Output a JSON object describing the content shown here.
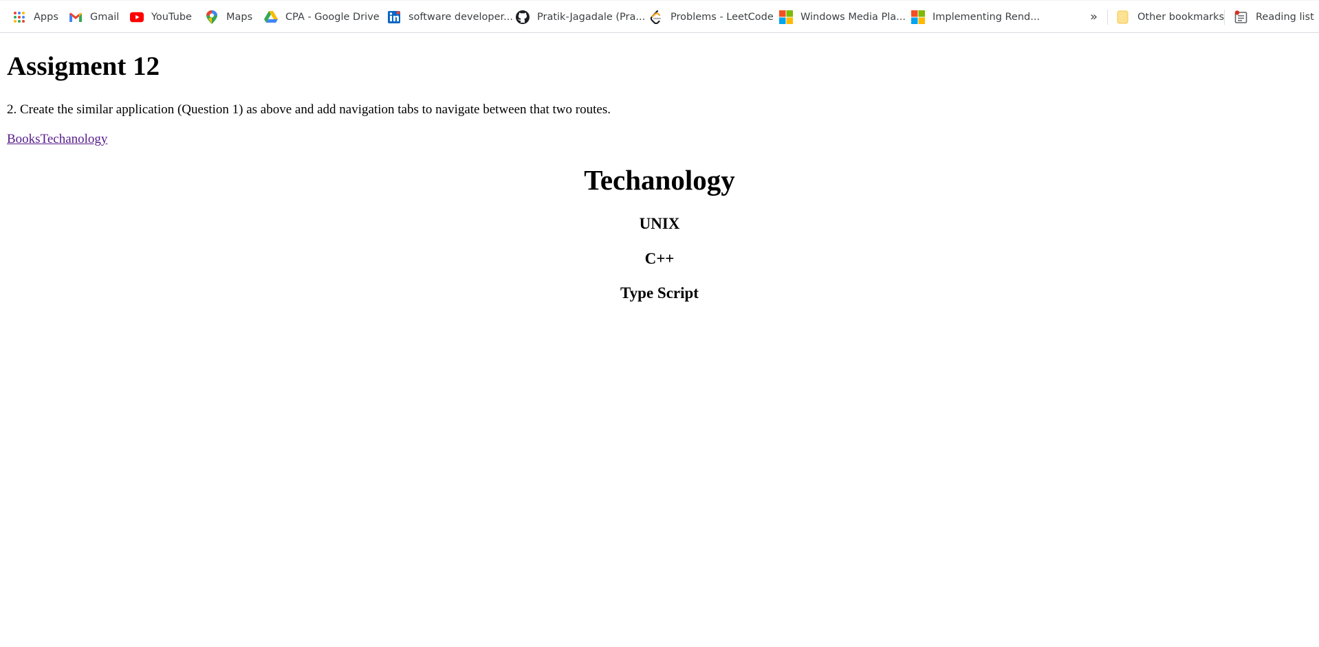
{
  "bookmarks": {
    "items": [
      {
        "label": "Apps",
        "icon": "apps-grid-icon"
      },
      {
        "label": "Gmail",
        "icon": "gmail-icon"
      },
      {
        "label": "YouTube",
        "icon": "youtube-icon"
      },
      {
        "label": "Maps",
        "icon": "maps-pin-icon"
      },
      {
        "label": "CPA - Google Drive",
        "icon": "google-drive-icon"
      },
      {
        "label": "software developer...",
        "icon": "linkedin-icon"
      },
      {
        "label": "Pratik-Jagadale (Pra...",
        "icon": "github-icon"
      },
      {
        "label": "Problems - LeetCode",
        "icon": "leetcode-icon"
      },
      {
        "label": "Windows Media Pla...",
        "icon": "microsoft-icon"
      },
      {
        "label": "Implementing Rend...",
        "icon": "microsoft-icon"
      }
    ],
    "overflow": "»",
    "other_bookmarks": "Other bookmarks",
    "reading_list": "Reading list"
  },
  "page": {
    "title": "Assigment 12",
    "question": "2. Create the similar application (Question 1) as above and add navigation tabs to navigate between that two routes.",
    "nav": {
      "books": "Books",
      "technology": "Techanology"
    },
    "route": {
      "heading": "Techanology",
      "items": [
        "UNIX",
        "C++",
        "Type Script"
      ]
    }
  },
  "colors": {
    "link_visited": "#551a8b",
    "bookmark_text": "#3c4043"
  }
}
